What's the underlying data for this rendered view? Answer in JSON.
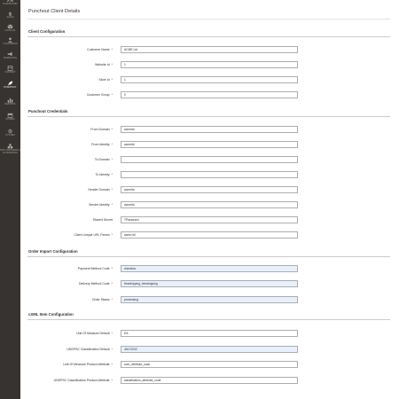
{
  "sidebar": {
    "items": [
      {
        "label": "Dashboard",
        "icon": "dashboard-icon",
        "active": false
      },
      {
        "label": "Sales",
        "icon": "dollar-icon",
        "active": false
      },
      {
        "label": "Catalog",
        "icon": "cube-icon",
        "active": false
      },
      {
        "label": "Customers",
        "icon": "user-icon",
        "active": false
      },
      {
        "label": "Marketing",
        "icon": "megaphone-icon",
        "active": false
      },
      {
        "label": "Content",
        "icon": "layout-icon",
        "active": false
      },
      {
        "label": "Punchout",
        "icon": "rocket-icon",
        "active": true
      },
      {
        "label": "Reports",
        "icon": "bar-chart-icon",
        "active": false
      },
      {
        "label": "Stores",
        "icon": "store-icon",
        "active": false
      },
      {
        "label": "System",
        "icon": "gear-icon",
        "active": false
      },
      {
        "label": "Find Partners & Extensions",
        "icon": "cubes-icon",
        "active": false
      }
    ]
  },
  "page": {
    "title": "Punchout Client Details"
  },
  "sections": {
    "client": {
      "title": "Client Configuration",
      "customer_name": {
        "label": "Customer Name",
        "value": "ACME Ltd"
      },
      "website_id": {
        "label": "Website Id",
        "value": "1"
      },
      "store_id": {
        "label": "Store Id",
        "value": "1"
      },
      "customer_group": {
        "label": "Customer Group",
        "value": "0"
      }
    },
    "credentials": {
      "title": "Punchout Credentials",
      "from_domain": {
        "label": "From Domain",
        "value": "acmeltd"
      },
      "from_identity": {
        "label": "From Identity",
        "value": "acmeltd"
      },
      "to_domain": {
        "label": "To Domain",
        "value": ""
      },
      "to_identity": {
        "label": "To Identity",
        "value": ""
      },
      "sender_domain": {
        "label": "Sender Domain",
        "value": "acmeltd"
      },
      "sender_identity": {
        "label": "Sender Identity",
        "value": "acmeltd"
      },
      "shared_secret": {
        "label": "Shared Secret",
        "value": "TPassword"
      },
      "client_unique_url_param": {
        "label": "Client Unique URL Param",
        "value": "acme-ltd"
      }
    },
    "order_import": {
      "title": "Order Import Configuration",
      "payment_method_code": {
        "label": "Payment Method Code",
        "value": "checkmo"
      },
      "delivery_method_code": {
        "label": "Delivery Method Code",
        "value": "freeshipping_freeshipping"
      },
      "order_status": {
        "label": "Order Status",
        "value": "processing"
      }
    },
    "cxml_item": {
      "title": "cXML Item Configuration",
      "uom_default": {
        "label": "Unit Of Measure Default",
        "value": "EA"
      },
      "unspsc_default": {
        "label": "UNSPSC Classification Default",
        "value": "46172202"
      },
      "uom_attribute": {
        "label": "Unit Of Measure Product Attribute",
        "value": "uom_attribute_code"
      },
      "unspsc_attribute": {
        "label": "UNSPSC Classification Product Attribute",
        "value": "classification_attribute_code"
      }
    }
  },
  "colors": {
    "sidebar_bg": "#373330",
    "required_asterisk": "#e22626",
    "autofill_bg": "#e8f0fe"
  }
}
